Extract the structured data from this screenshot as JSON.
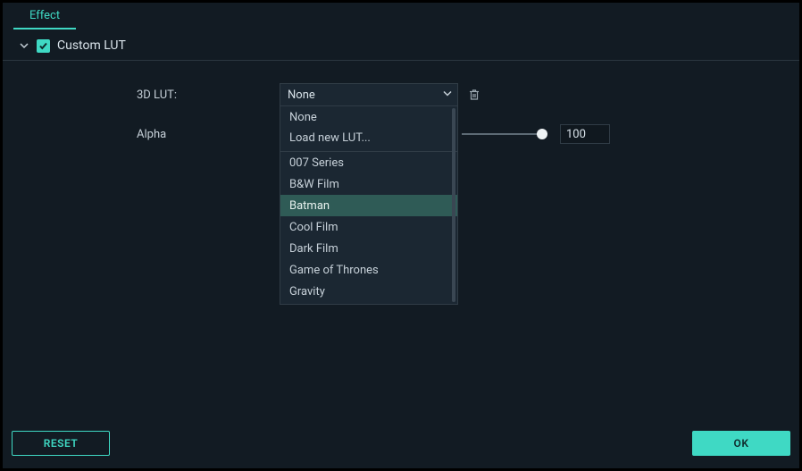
{
  "tabs": {
    "effect": "Effect"
  },
  "section": {
    "title": "Custom LUT"
  },
  "form": {
    "lut_label": "3D LUT:",
    "lut_value": "None",
    "alpha_label": "Alpha",
    "alpha_value": "100"
  },
  "dropdown": {
    "items": [
      "None",
      "Load new LUT...",
      "007 Series",
      "B&W Film",
      "Batman",
      "Cool Film",
      "Dark Film",
      "Game of Thrones",
      "Gravity"
    ],
    "hover_index": 4,
    "separator_after_index": 1
  },
  "footer": {
    "reset": "RESET",
    "ok": "OK"
  }
}
